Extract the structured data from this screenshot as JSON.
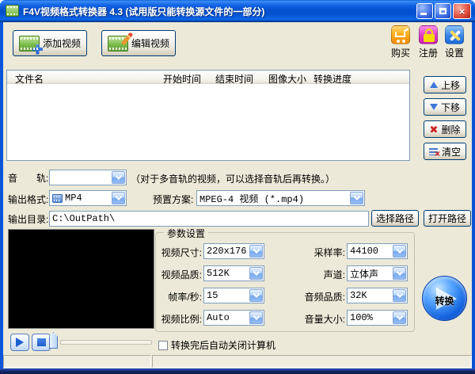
{
  "window": {
    "title": "F4V视频格式转换器 4.3 (试用版只能转换源文件的一部分)"
  },
  "toolbar": {
    "add_video": "添加视频",
    "edit_video": "编辑视频"
  },
  "quick_actions": {
    "buy": "购买",
    "register": "注册",
    "settings": "设置"
  },
  "file_table": {
    "columns": [
      "文件名",
      "开始时间",
      "结束时间",
      "图像大小",
      "转换进度"
    ],
    "rows": []
  },
  "list_buttons": {
    "move_up": "上移",
    "move_down": "下移",
    "delete": "删除",
    "clear": "清空"
  },
  "audio_track": {
    "label": "音　　轨:",
    "value": "",
    "hint": "（对于多音轨的视频，可以选择音轨后再转换。）"
  },
  "output_format": {
    "label": "输出格式:",
    "value": "MP4"
  },
  "preset": {
    "label": "预置方案:",
    "value": "MPEG-4 视频 (*.mp4)"
  },
  "output_dir": {
    "label": "输出目录:",
    "value": "C:\\OutPath\\",
    "select_button": "选择路径",
    "open_button": "打开路径"
  },
  "params": {
    "title": "参数设置",
    "video_size": {
      "label": "视频尺寸:",
      "value": "220x176"
    },
    "sample_rate": {
      "label": "采样率:",
      "value": "44100"
    },
    "video_quality": {
      "label": "视频品质:",
      "value": "512K"
    },
    "channels": {
      "label": "声道:",
      "value": "立体声"
    },
    "frame_rate": {
      "label": "帧率/秒:",
      "value": "15"
    },
    "audio_quality": {
      "label": "音频品质:",
      "value": "32K"
    },
    "aspect_ratio": {
      "label": "视频比例:",
      "value": "Auto"
    },
    "volume": {
      "label": "音量大小:",
      "value": "100%"
    }
  },
  "shutdown_option": {
    "label": "转换完后自动关闭计算机",
    "checked": false
  },
  "convert": {
    "label": "转换"
  },
  "icons": {
    "app": "film-icon",
    "add": "film-plus-icon",
    "edit": "film-pencil-icon",
    "buy": "cart-icon",
    "register": "lock-icon",
    "settings": "tools-icon"
  },
  "colors": {
    "titlebar_blue": "#0351CE",
    "window_border": "#0A55D8",
    "dialog_bg": "#ECE9D8",
    "control_border": "#7F9DB9",
    "button_border": "#003C74",
    "accent_blue": "#1E5FD0",
    "delete_red": "#CC2020"
  }
}
